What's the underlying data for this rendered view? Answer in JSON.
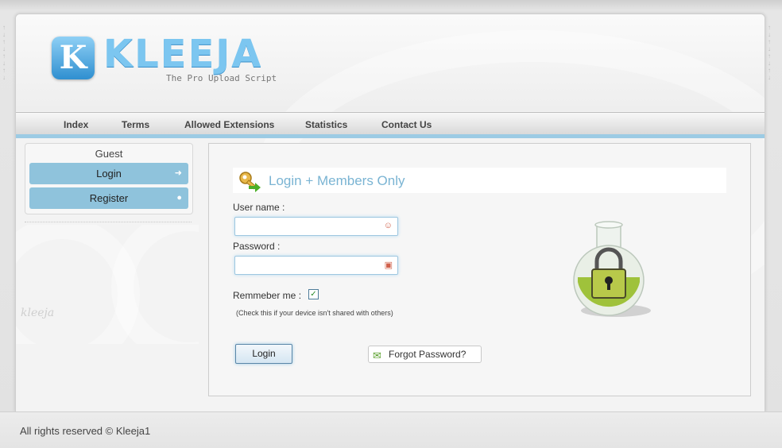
{
  "brand": {
    "logo_letter": "K",
    "name": "KLEEJA",
    "tagline": "The Pro Upload Script",
    "watermark": "kleeja"
  },
  "nav": {
    "items": [
      {
        "label": "Index"
      },
      {
        "label": "Terms"
      },
      {
        "label": "Allowed Extensions"
      },
      {
        "label": "Statistics"
      },
      {
        "label": "Contact Us"
      }
    ]
  },
  "sidebar": {
    "user": "Guest",
    "buttons": [
      {
        "label": "Login",
        "icon": "sign-in-icon"
      },
      {
        "label": "Register",
        "icon": "user-add-icon"
      }
    ]
  },
  "login": {
    "title": "Login + Members Only",
    "username_label": "User name :",
    "username_value": "",
    "password_label": "Password :",
    "password_value": "",
    "remember_label": "Remmeber me :",
    "remember_checked": true,
    "remember_hint": "(Check this if your device isn't shared with others)",
    "submit_label": "Login",
    "forgot_label": "Forgot Password?"
  },
  "colors": {
    "accent": "#8fc3dc",
    "title": "#7ab4d3",
    "nav_line": "#9ccbe4"
  },
  "footer": {
    "text": "All rights reserved © Kleeja1"
  }
}
